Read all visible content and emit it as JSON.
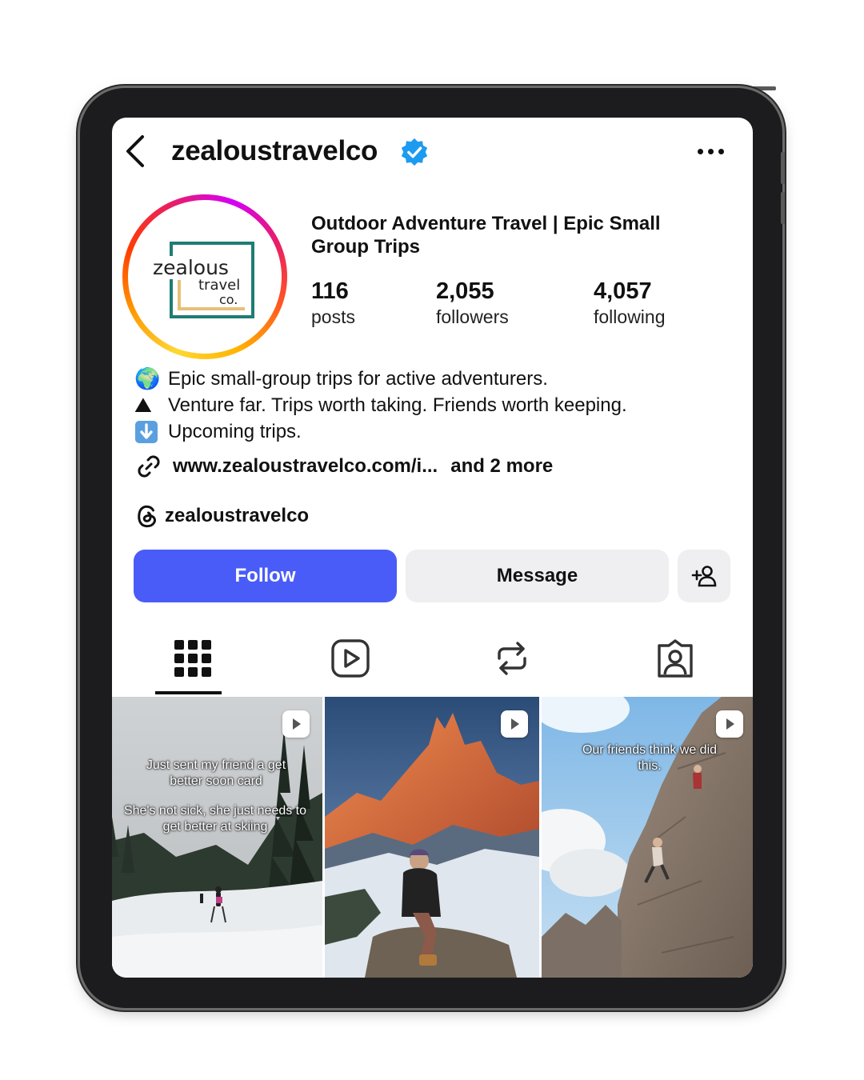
{
  "header": {
    "username": "zealoustravelco",
    "back_icon": "chevron-left-icon",
    "verified_icon": "verified-badge-icon",
    "more_icon": "more-horizontal-icon"
  },
  "avatar": {
    "logo_line1": "zealous",
    "logo_line2": "travel",
    "logo_line3": "co."
  },
  "profile": {
    "display_name": "Outdoor Adventure Travel | Epic Small Group Trips",
    "stats": [
      {
        "number": "116",
        "label": "posts"
      },
      {
        "number": "2,055",
        "label": "followers"
      },
      {
        "number": "4,057",
        "label": "following"
      }
    ]
  },
  "bio": {
    "lines": [
      {
        "emoji": "🌍",
        "text": "Epic small-group trips for active adventurers."
      },
      {
        "emoji": "⛰",
        "text": "Venture far. Trips worth taking. Friends worth keeping."
      },
      {
        "emoji": "⬇",
        "text": "Upcoming trips."
      }
    ],
    "link": "www.zealoustravelco.com/i...",
    "link_more": "and 2 more",
    "threads_handle": "zealoustravelco"
  },
  "actions": {
    "follow_label": "Follow",
    "message_label": "Message",
    "add_user_icon": "add-user-icon"
  },
  "tabs": [
    {
      "name": "posts",
      "icon": "grid-icon",
      "active": true
    },
    {
      "name": "reels",
      "icon": "reels-icon",
      "active": false
    },
    {
      "name": "reposts",
      "icon": "repost-icon",
      "active": false
    },
    {
      "name": "tagged",
      "icon": "tagged-icon",
      "active": false
    }
  ],
  "posts": [
    {
      "type": "reel",
      "caption_top": "Just sent my friend a get better soon card",
      "caption_bottom": "She's not sick, she just needs to get better at skiing"
    },
    {
      "type": "reel",
      "caption_top": "",
      "caption_bottom": ""
    },
    {
      "type": "reel",
      "caption_top": "Our friends think we did this.",
      "caption_bottom": ""
    }
  ],
  "colors": {
    "follow_button": "#4a5cf7",
    "secondary_button": "#efeff2",
    "verified": "#1d9bf0",
    "logo_teal": "#1e7d75",
    "logo_gold": "#e6c07a"
  }
}
